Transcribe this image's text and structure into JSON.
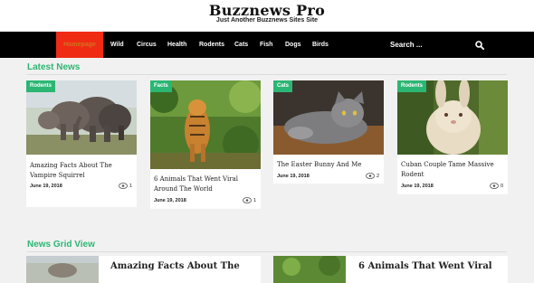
{
  "header": {
    "site_title": "Buzznews Pro",
    "tagline": "Just Another Buzznews Sites Site"
  },
  "nav": {
    "home": "Homepage",
    "items": [
      "Wild",
      "Circus",
      "Health",
      "Rodents",
      "Cats",
      "Fish",
      "Dogs",
      "Birds"
    ],
    "search_label": "Search ..."
  },
  "latest_news": {
    "title": "Latest News",
    "cards": [
      {
        "category": "Rodents",
        "title": "Amazing Facts About The Vampire Squirrel",
        "date": "June 19, 2018",
        "views": "1"
      },
      {
        "category": "Facts",
        "title": "6 Animals That Went Viral Around The World",
        "date": "June 19, 2018",
        "views": "1"
      },
      {
        "category": "Cats",
        "title": "The Easter Bunny And Me",
        "date": "June 19, 2018",
        "views": "2"
      },
      {
        "category": "Rodents",
        "title": "Cuban Couple Tame Massive Rodent",
        "date": "June 19, 2018",
        "views": "0"
      }
    ]
  },
  "news_grid": {
    "title": "News Grid View",
    "items": [
      {
        "title": "Amazing Facts About The"
      },
      {
        "title": "6 Animals That Went Viral"
      }
    ]
  },
  "colors": {
    "accent": "#2bb673",
    "nav_bg": "#000000",
    "home_active": "#ef2b14"
  }
}
